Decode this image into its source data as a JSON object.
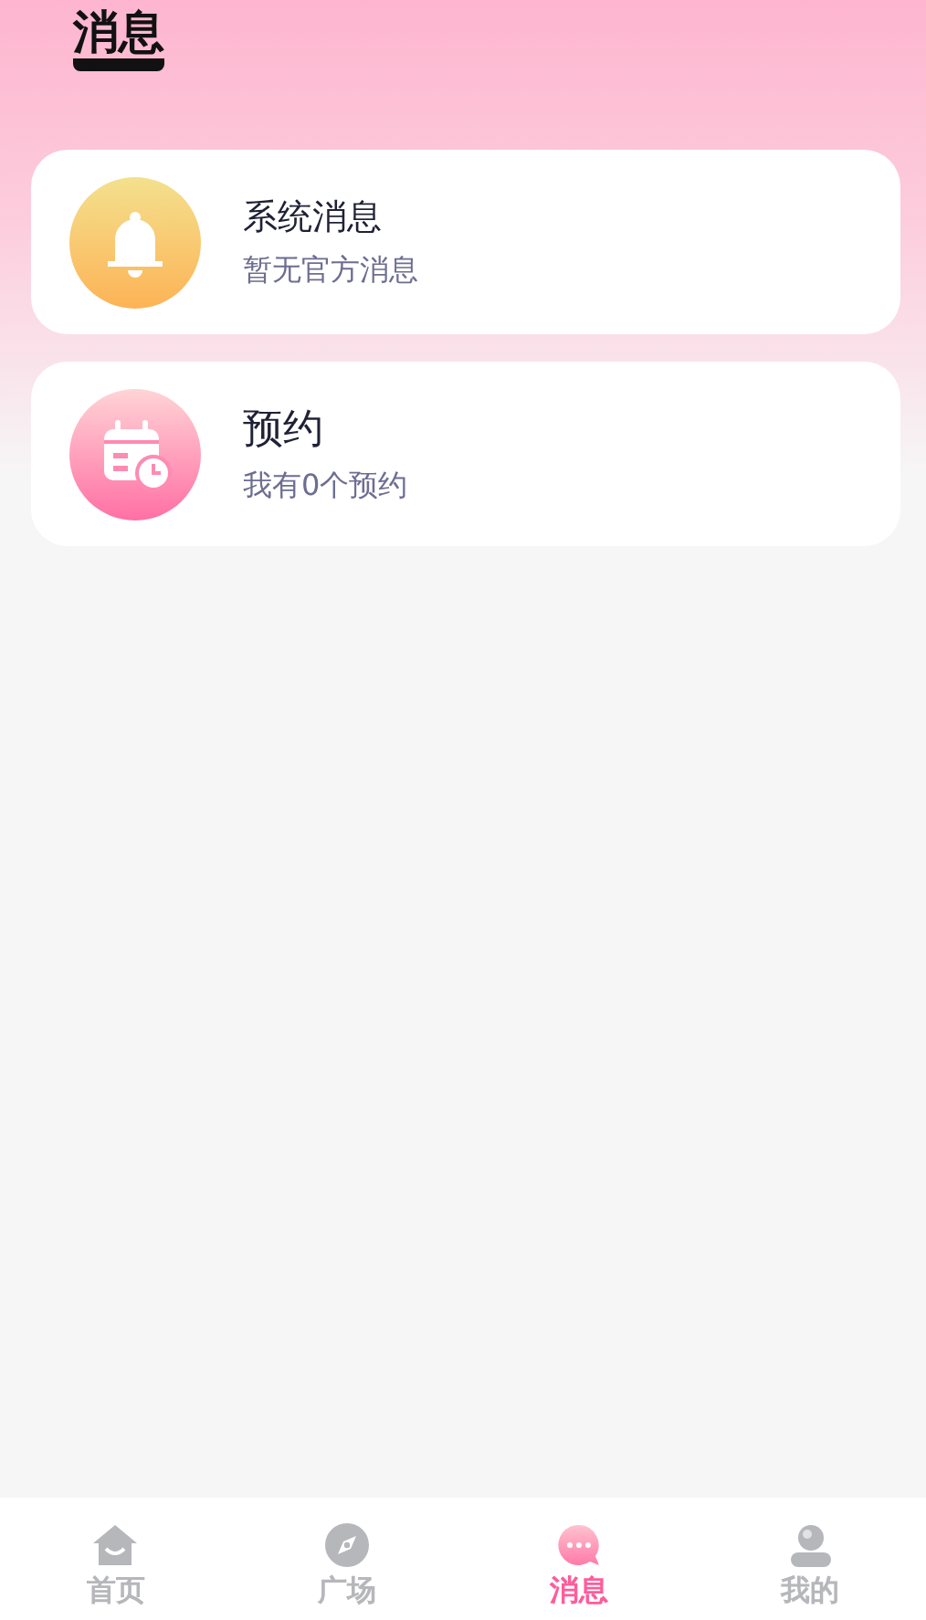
{
  "header": {
    "title": "消息"
  },
  "conversations": [
    {
      "kind": "bell",
      "title": "系统消息",
      "subtitle": "暂无官方消息"
    },
    {
      "kind": "calendar",
      "title": "预约",
      "subtitle": "我有0个预约"
    }
  ],
  "tab_bar": [
    {
      "kind": "home",
      "label": "首页",
      "selected": false
    },
    {
      "kind": "compass",
      "label": "广场",
      "selected": false
    },
    {
      "kind": "chat",
      "label": "消息",
      "selected": true
    },
    {
      "kind": "user",
      "label": "我的",
      "selected": false
    }
  ]
}
